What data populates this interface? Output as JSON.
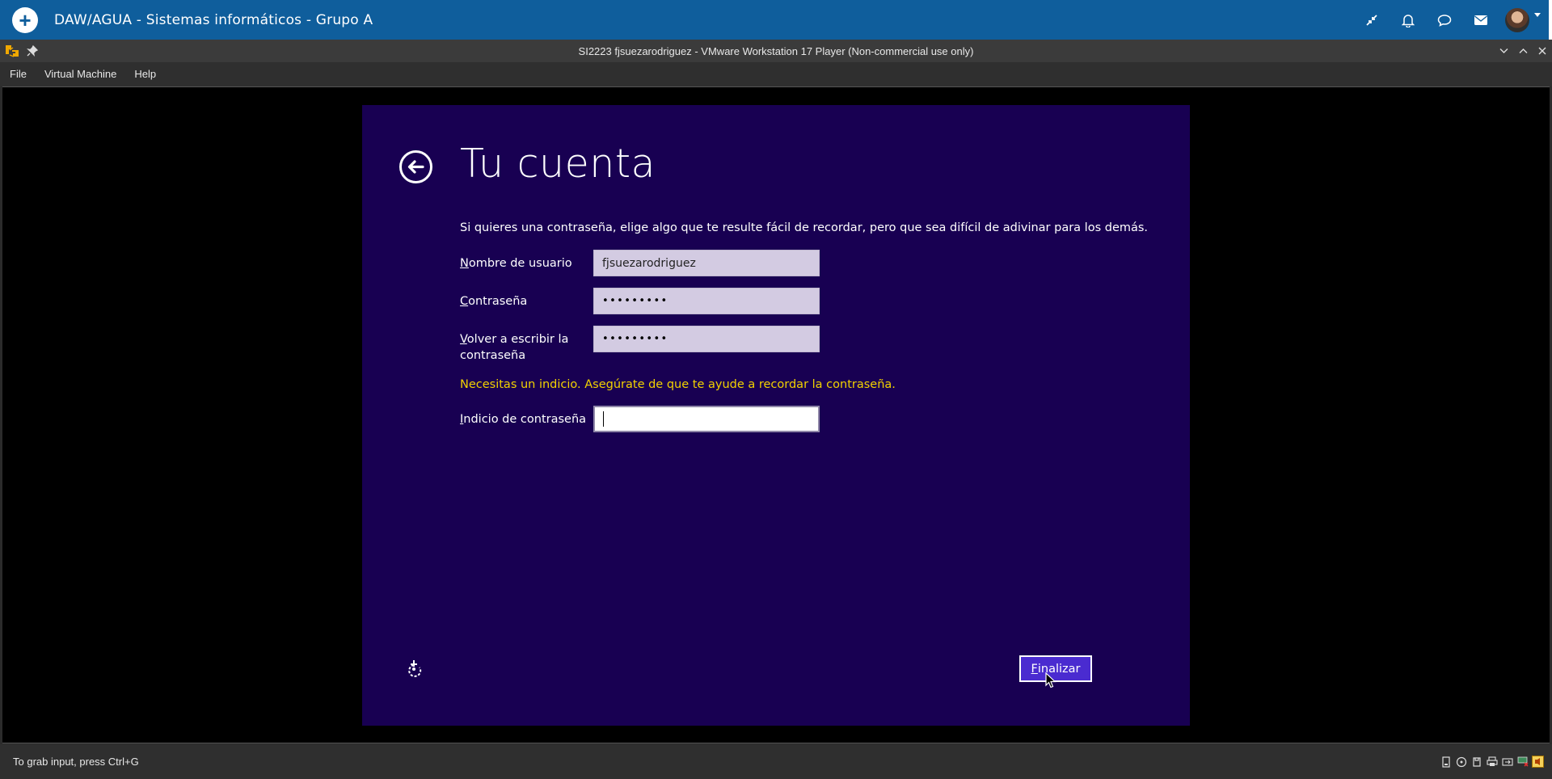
{
  "app": {
    "title": "DAW/AGUA - Sistemas informáticos - Grupo A",
    "icons": [
      "add-icon",
      "compress-icon",
      "bell-icon",
      "chat-icon",
      "mail-icon",
      "avatar"
    ]
  },
  "vmware": {
    "window_title": "SI2223 fjsuezarodriguez - VMware Workstation 17 Player (Non-commercial use only)",
    "menu": [
      "File",
      "Virtual Machine",
      "Help"
    ],
    "status_text": "To grab input, press Ctrl+G"
  },
  "oobe": {
    "heading": "Tu cuenta",
    "intro": "Si quieres una contraseña, elige algo que te resulte fácil de recordar, pero que sea difícil de adivinar para los demás.",
    "username_label_key": "N",
    "username_label_rest": "ombre de usuario",
    "username_value": "fjsuezarodriguez",
    "password_label_key": "C",
    "password_label_rest": "ontraseña",
    "password_value": "•••••••••",
    "confirm_label_key": "V",
    "confirm_label_rest": "olver a escribir la",
    "confirm_label_line2": "contraseña",
    "confirm_value": "•••••••••",
    "warning": "Necesitas un indicio. Asegúrate de que te ayude a recordar la contraseña.",
    "hint_label_key": "I",
    "hint_label_rest": "ndicio de contraseña",
    "hint_value": "",
    "finish_key": "F",
    "finish_rest": "inalizar",
    "background_color": "#180052",
    "warning_color": "#f2d200",
    "button_color": "#4a2bd0"
  }
}
